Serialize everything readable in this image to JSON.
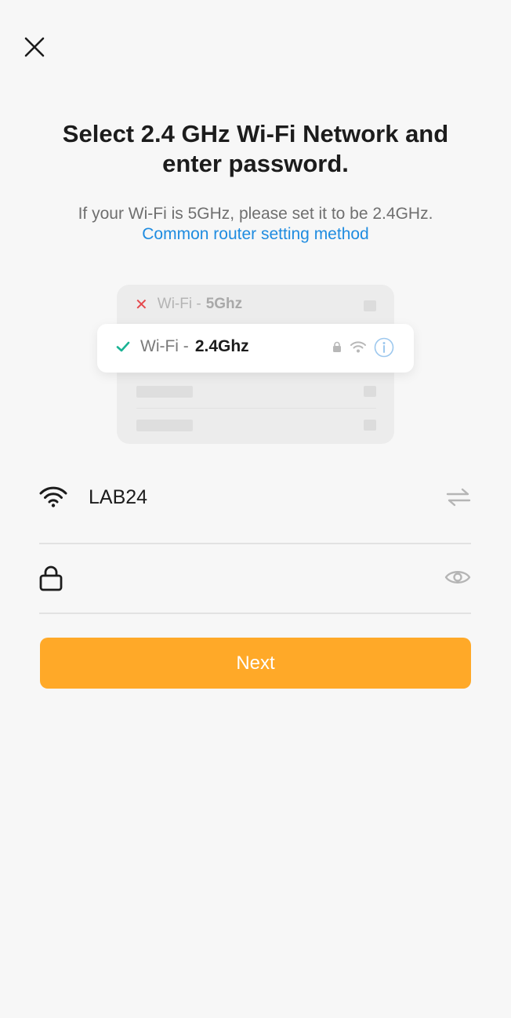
{
  "header": {
    "close_icon": "close-icon"
  },
  "title": "Select 2.4 GHz Wi-Fi Network and enter password.",
  "subtitle": "If your Wi-Fi is 5GHz, please set it to be 2.4GHz.",
  "router_link": "Common router setting method",
  "illustration": {
    "row_5g": {
      "prefix": "Wi-Fi -",
      "band": "5Ghz",
      "status_icon": "x-mark-icon",
      "status_color": "#e5484d"
    },
    "row_24g": {
      "prefix": "Wi-Fi -",
      "band": "2.4Ghz",
      "status_icon": "check-icon",
      "status_color": "#1ab394",
      "icons": [
        "lock-icon",
        "wifi-icon",
        "info-icon"
      ]
    }
  },
  "form": {
    "ssid": "LAB24",
    "password_value": "",
    "password_placeholder": ""
  },
  "actions": {
    "next_label": "Next"
  },
  "colors": {
    "accent": "#ffa928",
    "link": "#1f8ce0",
    "background": "#f7f7f7"
  }
}
